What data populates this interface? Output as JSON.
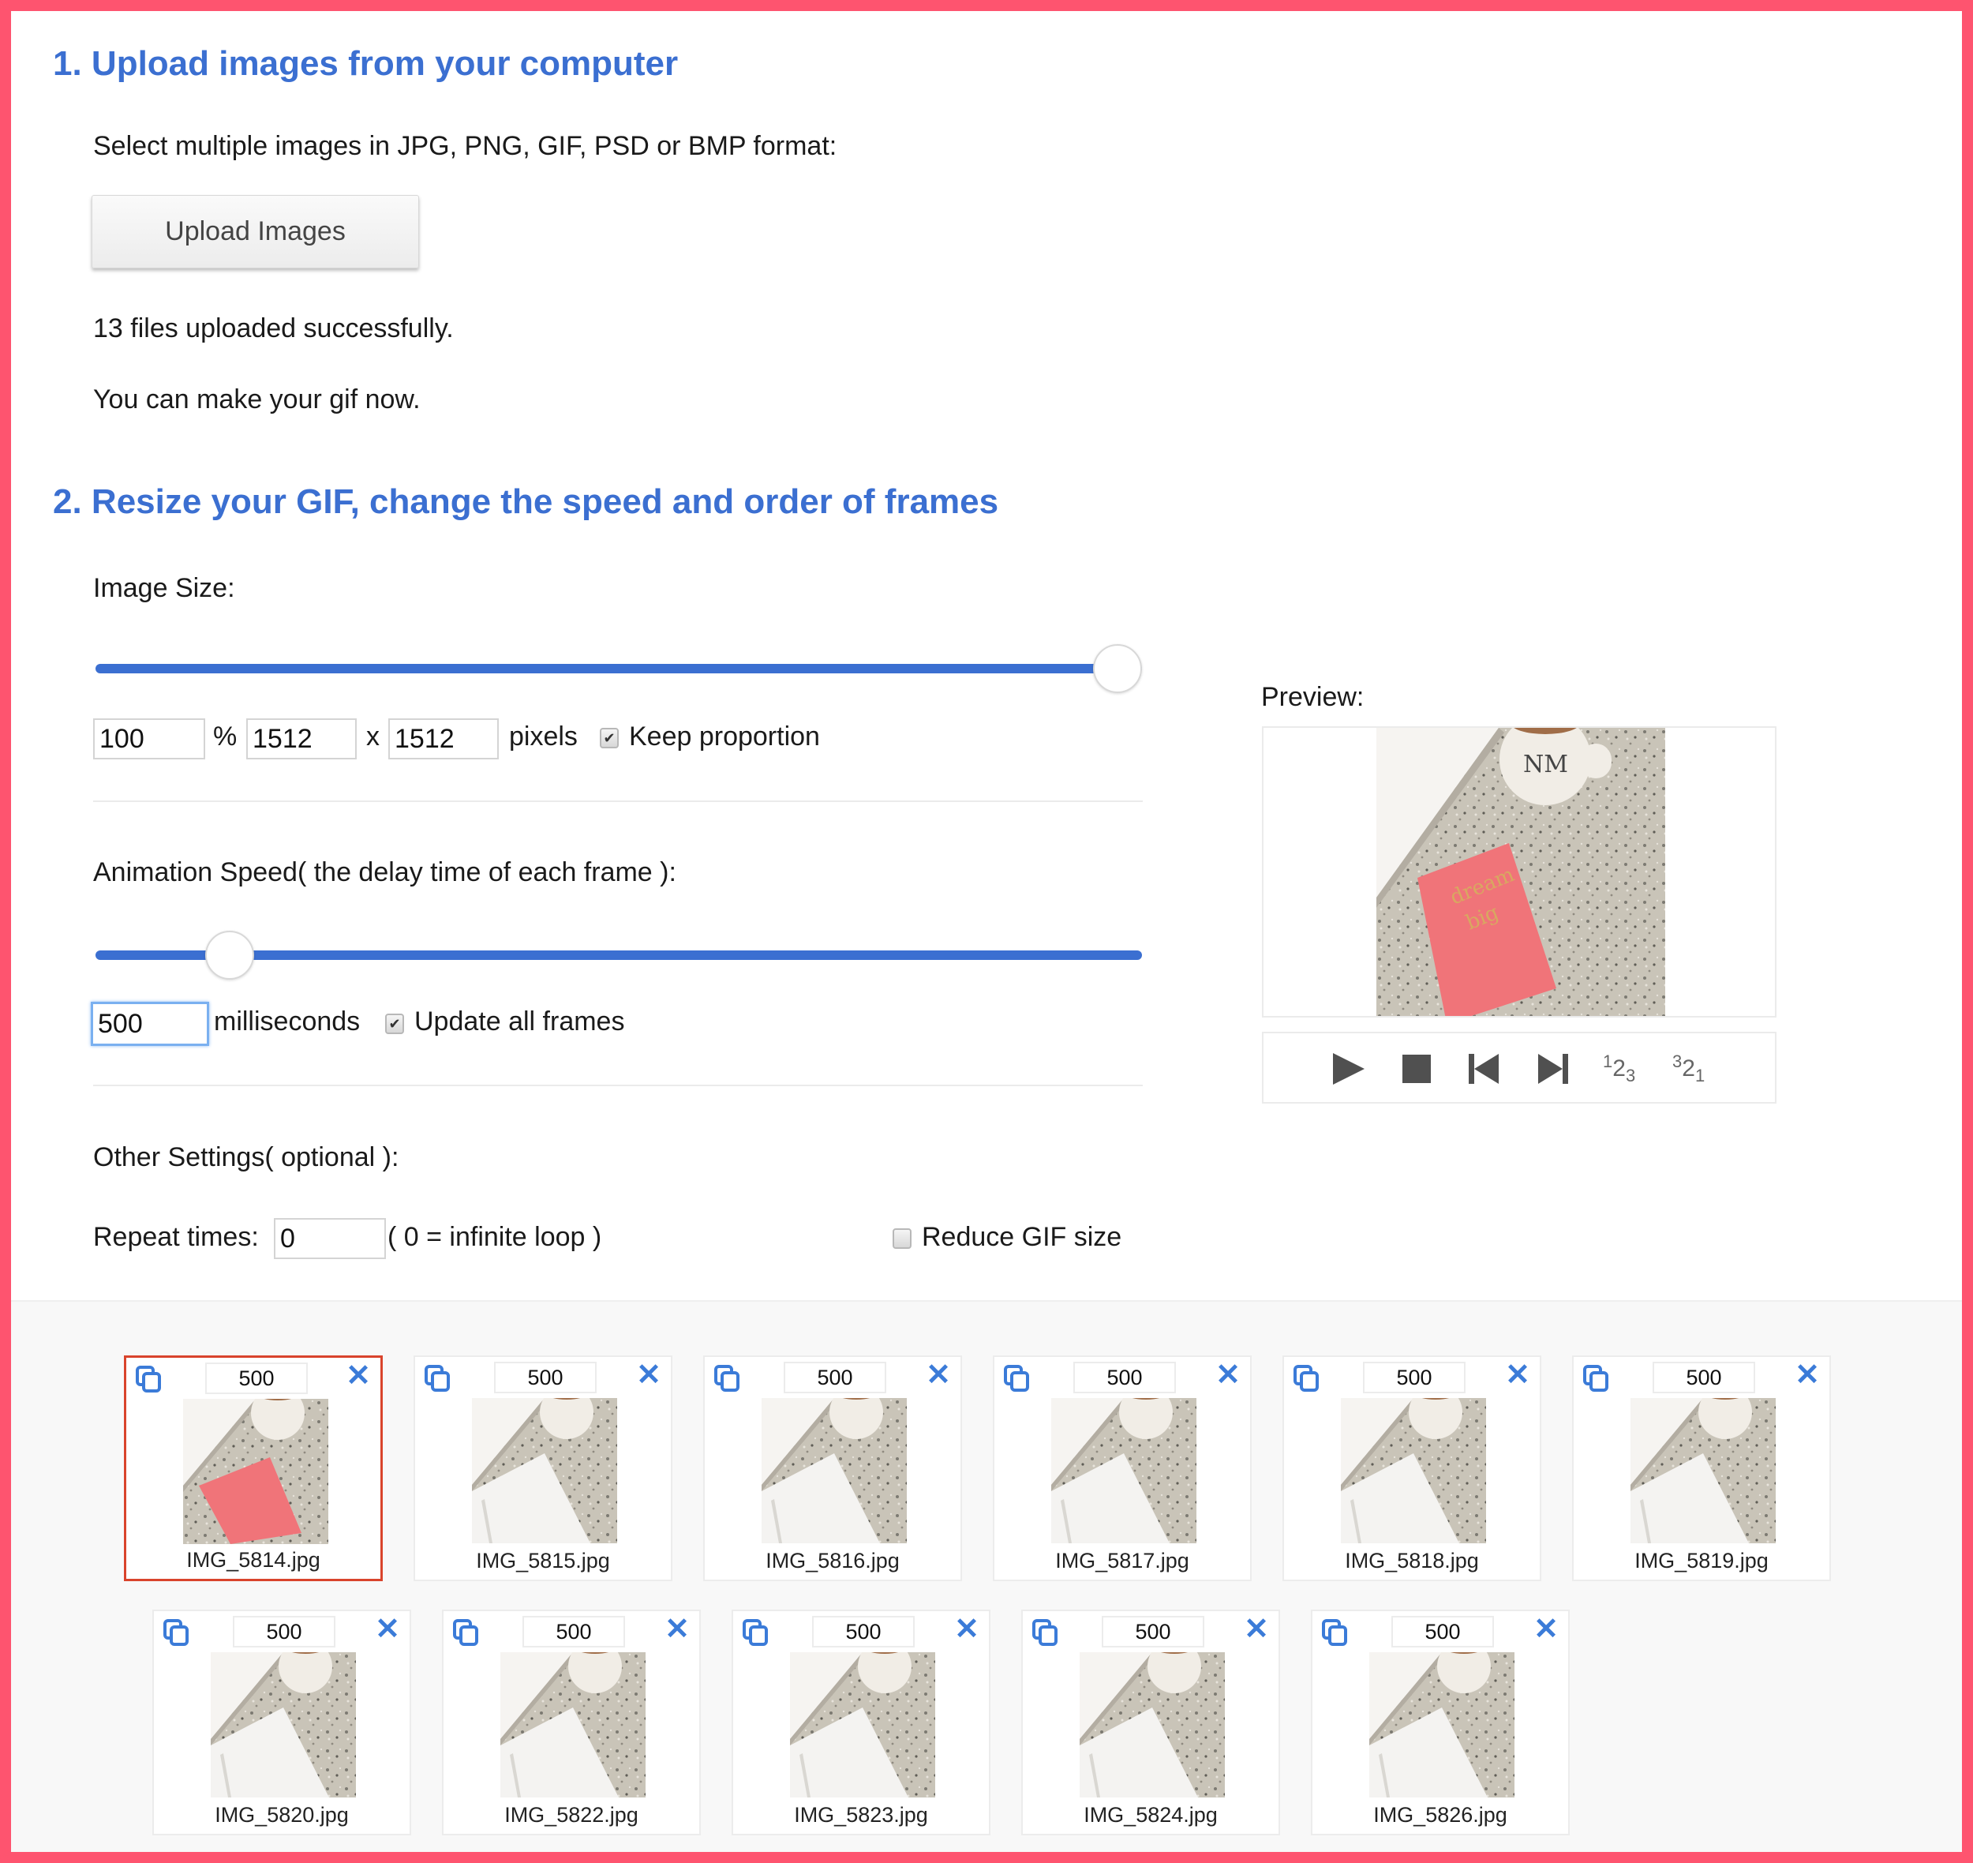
{
  "section1": {
    "heading": "1. Upload images from your computer",
    "instructions": "Select multiple images in JPG, PNG, GIF, PSD or BMP format:",
    "upload_button": "Upload Images",
    "status_line1": "13 files uploaded successfully.",
    "status_line2": "You can make your gif now."
  },
  "section2": {
    "heading": "2. Resize your GIF, change the speed and order of frames",
    "image_size": {
      "label": "Image Size:",
      "slider_percent": 100,
      "percent_value": "100",
      "percent_symbol": "%",
      "width_value": "1512",
      "times_symbol": "x",
      "height_value": "1512",
      "pixels_label": "pixels",
      "keep_proportion_label": "Keep proportion",
      "keep_proportion_checked": true
    },
    "animation_speed": {
      "label": "Animation Speed( the delay time of each frame ):",
      "slider_fraction": 0.11,
      "delay_value": "500",
      "ms_label": "milliseconds",
      "update_all_label": "Update all frames",
      "update_all_checked": true
    },
    "other_settings": {
      "label": "Other Settings( optional ):",
      "repeat_label": "Repeat times:",
      "repeat_value": "0",
      "repeat_hint": "( 0 = infinite loop )",
      "reduce_label": "Reduce GIF size",
      "reduce_checked": false
    }
  },
  "preview": {
    "label": "Preview:",
    "controls": [
      {
        "name": "play-icon",
        "glyph": "play"
      },
      {
        "name": "stop-icon",
        "glyph": "stop"
      },
      {
        "name": "previous-frame-icon",
        "glyph": "prev"
      },
      {
        "name": "next-frame-icon",
        "glyph": "next"
      },
      {
        "name": "order-ascending-icon",
        "glyph": "123"
      },
      {
        "name": "order-descending-icon",
        "glyph": "321"
      }
    ]
  },
  "frames": [
    {
      "file": "IMG_5814.jpg",
      "delay": "500",
      "selected": true,
      "variant": "pink"
    },
    {
      "file": "IMG_5815.jpg",
      "delay": "500",
      "selected": false,
      "variant": "white"
    },
    {
      "file": "IMG_5816.jpg",
      "delay": "500",
      "selected": false,
      "variant": "white"
    },
    {
      "file": "IMG_5817.jpg",
      "delay": "500",
      "selected": false,
      "variant": "white"
    },
    {
      "file": "IMG_5818.jpg",
      "delay": "500",
      "selected": false,
      "variant": "white"
    },
    {
      "file": "IMG_5819.jpg",
      "delay": "500",
      "selected": false,
      "variant": "white"
    },
    {
      "file": "IMG_5820.jpg",
      "delay": "500",
      "selected": false,
      "variant": "white"
    },
    {
      "file": "IMG_5822.jpg",
      "delay": "500",
      "selected": false,
      "variant": "white"
    },
    {
      "file": "IMG_5823.jpg",
      "delay": "500",
      "selected": false,
      "variant": "white"
    },
    {
      "file": "IMG_5824.jpg",
      "delay": "500",
      "selected": false,
      "variant": "white"
    },
    {
      "file": "IMG_5826.jpg",
      "delay": "500",
      "selected": false,
      "variant": "white"
    }
  ],
  "colors": {
    "frame_border": "#fe546f",
    "heading": "#3b6fd1",
    "slider": "#3b6fd1",
    "selected_frame": "#d9442c",
    "icon_blue": "#3b7bd8"
  }
}
